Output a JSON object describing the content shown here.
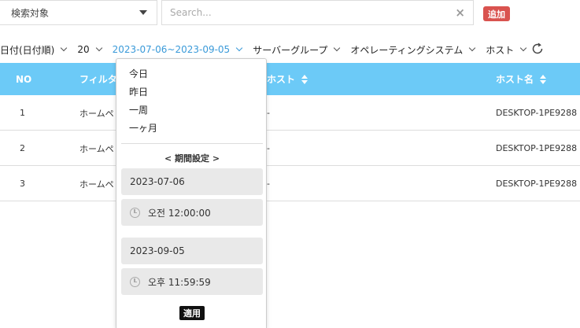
{
  "topbar": {
    "search_target_label": "検索対象",
    "search_placeholder": "Search...",
    "clear_glyph": "×",
    "add_label": "追加"
  },
  "filters": {
    "sort": "日付(日付順)",
    "page_size": "20",
    "date_range": "2023-07-06~2023-09-05",
    "server_group": "サーバーグループ",
    "os": "オペレーティングシステム",
    "host": "ホスト"
  },
  "table": {
    "headers": {
      "no": "NO",
      "filter": "フィルタ",
      "host": "ホスト",
      "host_name": "ホスト名"
    },
    "rows": [
      {
        "no": "1",
        "filter": "ホームペ",
        "host": "-",
        "host_name": "DESKTOP-1PE9288"
      },
      {
        "no": "2",
        "filter": "ホームペ",
        "host": "-",
        "host_name": "DESKTOP-1PE9288"
      },
      {
        "no": "3",
        "filter": "ホームペ",
        "host": "-",
        "host_name": "DESKTOP-1PE9288"
      }
    ]
  },
  "date_dropdown": {
    "presets": [
      "今日",
      "昨日",
      "一周",
      "一ヶ月"
    ],
    "period_label": "< 期間設定 >",
    "start_date": "2023-07-06",
    "start_time": "오전 12:00:00",
    "end_date": "2023-09-05",
    "end_time": "오후 11:59:59",
    "apply_label": "適用"
  },
  "colors": {
    "header_bg": "#6ccaf7",
    "active_filter": "#3a9ad9",
    "add_button": "#d9534f",
    "apply_button": "#111111"
  }
}
